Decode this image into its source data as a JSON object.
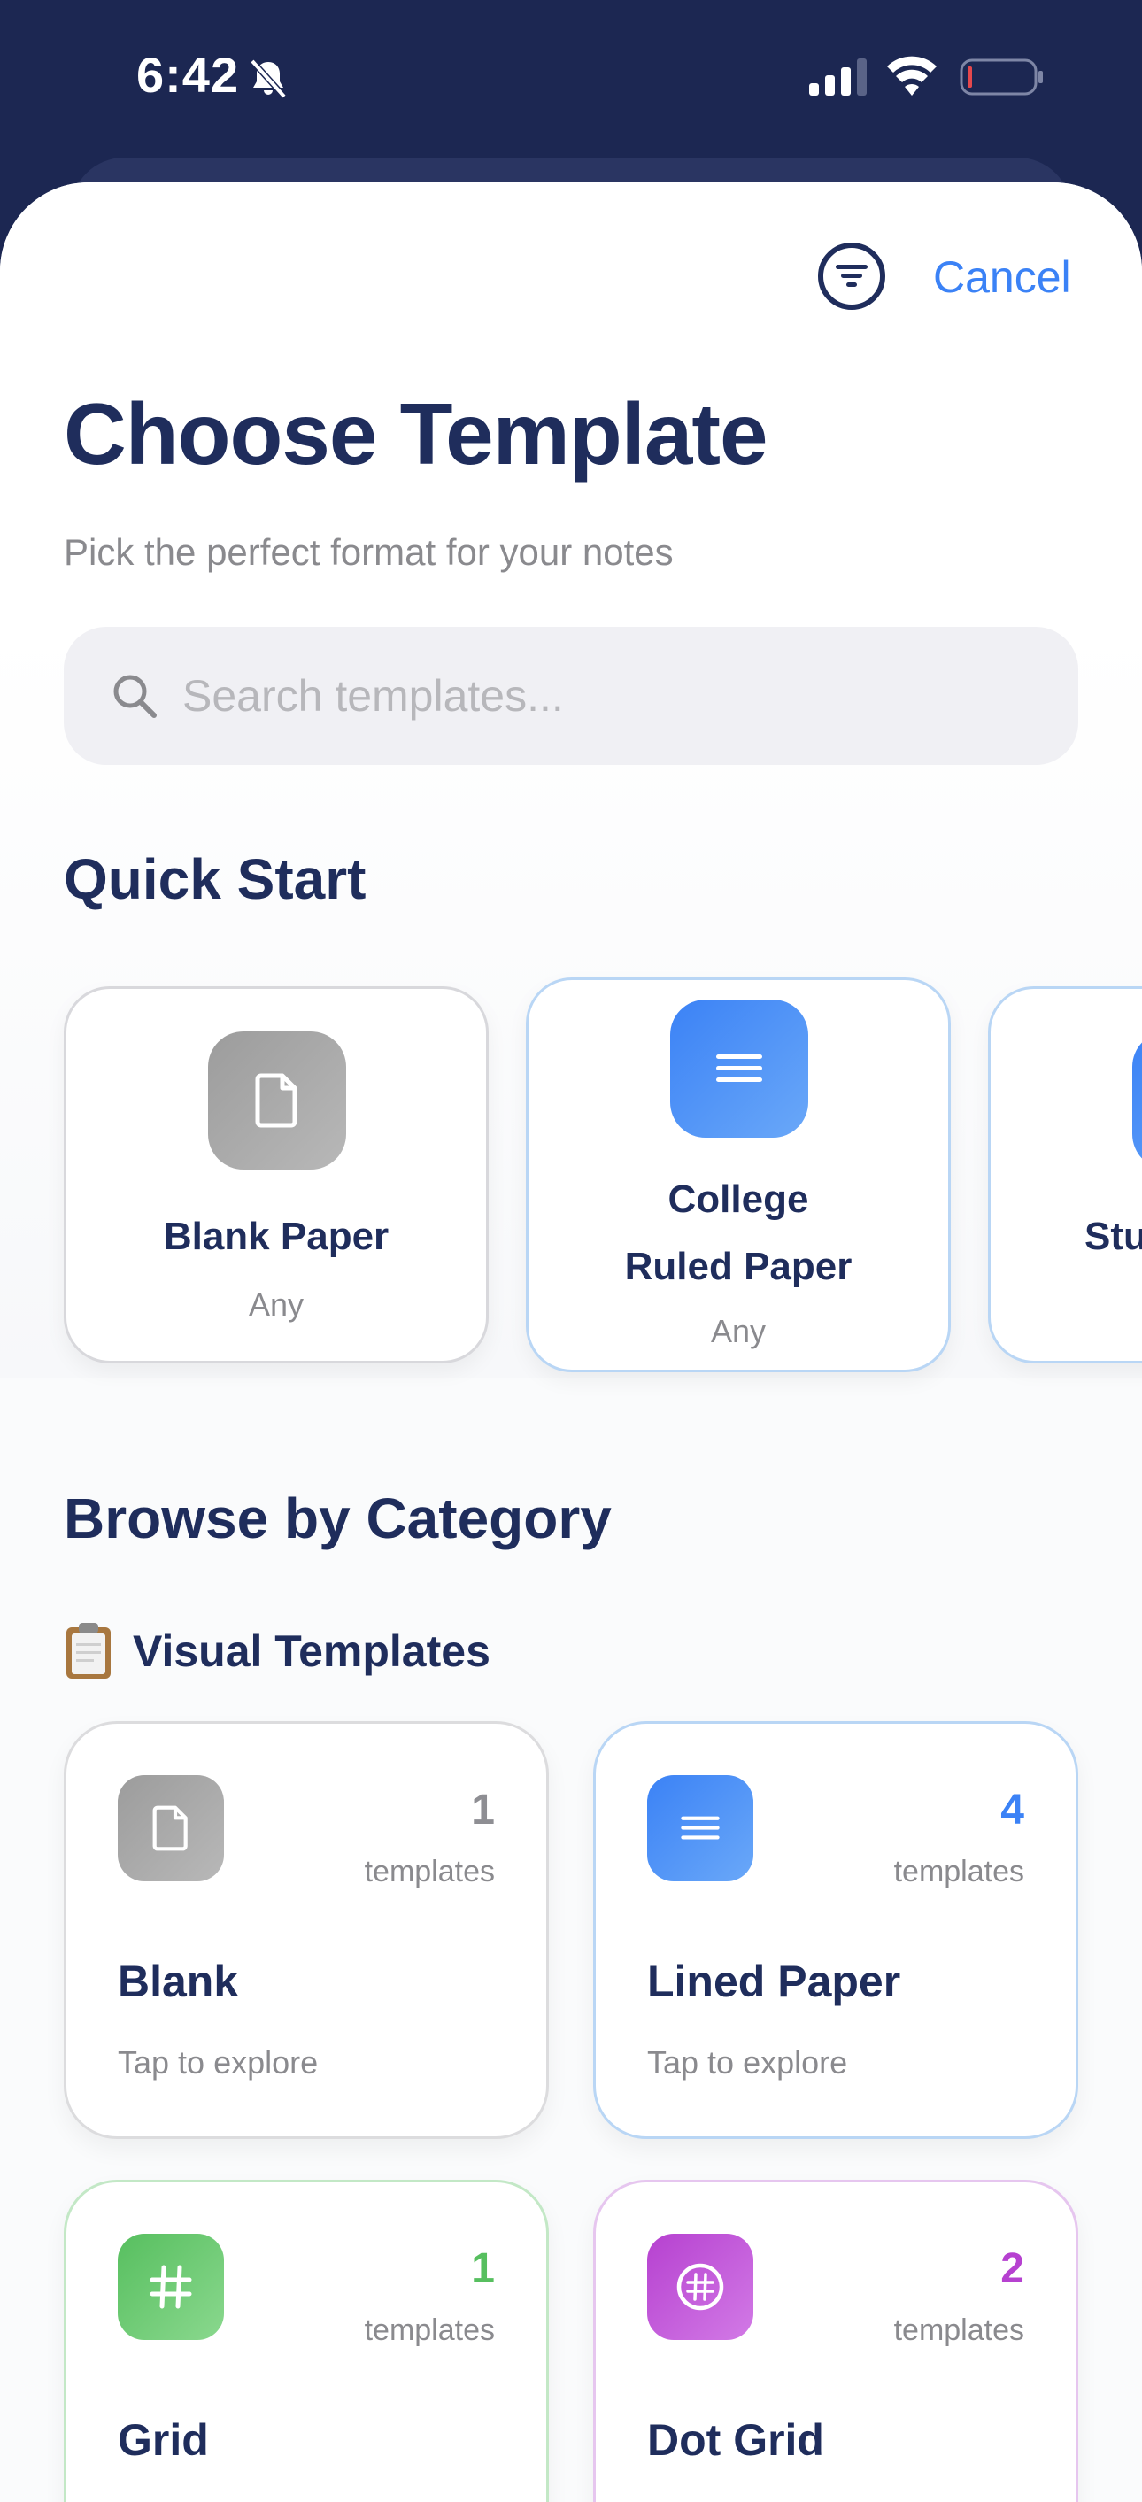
{
  "status_bar": {
    "time": "6:42",
    "icons": [
      "bell-slash-icon",
      "signal-icon",
      "wifi-icon",
      "battery-low-icon"
    ]
  },
  "header": {
    "filter_icon": "filter-icon",
    "cancel_label": "Cancel",
    "title": "Choose Template",
    "subtitle": "Pick the perfect format for your notes"
  },
  "search": {
    "placeholder": "Search templates...",
    "value": ""
  },
  "quick_start": {
    "title": "Quick Start",
    "cards": [
      {
        "name": "Blank Paper",
        "sub": "Any",
        "icon": "document-icon"
      },
      {
        "name_line1": "College",
        "name_line2": "Ruled Paper",
        "sub": "Any",
        "icon": "lines-icon"
      },
      {
        "name": "Stu",
        "icon": "lines-icon"
      }
    ]
  },
  "browse": {
    "title": "Browse by Category",
    "subsection": "Visual Templates",
    "subsection_icon": "clipboard-icon",
    "categories": [
      {
        "name": "Blank",
        "count": "1",
        "unit": "templates",
        "tap": "Tap to explore",
        "color": "#8e8e93",
        "icon": "document-icon"
      },
      {
        "name": "Lined Paper",
        "count": "4",
        "unit": "templates",
        "tap": "Tap to explore",
        "color": "#3b82f6",
        "icon": "lines-icon"
      },
      {
        "name": "Grid",
        "count": "1",
        "unit": "templates",
        "color": "#57bf5f",
        "icon": "hash-icon"
      },
      {
        "name": "Dot Grid",
        "count": "2",
        "unit": "templates",
        "color": "#b641d0",
        "icon": "circled-hash-icon"
      }
    ]
  },
  "colors": {
    "navy": "#1c2752",
    "title": "#1f2d5c",
    "accent": "#3b82f6"
  }
}
